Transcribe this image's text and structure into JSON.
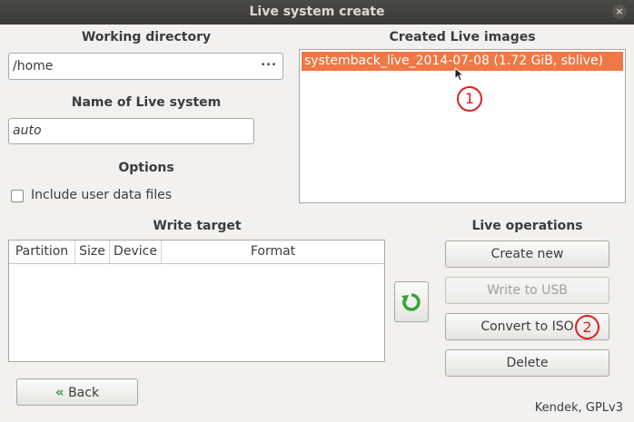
{
  "window": {
    "title": "Live system create",
    "close_glyph": "×"
  },
  "left": {
    "working_dir_label": "Working directory",
    "working_dir_value": "/home",
    "browse_label": "...",
    "name_label": "Name of Live system",
    "name_value": "auto",
    "options_label": "Options",
    "include_user_data_label": "Include user data files",
    "include_user_data_checked": false,
    "write_target_label": "Write target",
    "columns": [
      "Partition",
      "Size",
      "Device",
      "Format"
    ]
  },
  "right": {
    "created_label": "Created Live images",
    "images": [
      "systemback_live_2014-07-08 (1.72 GiB, sblive)"
    ],
    "operations_label": "Live operations",
    "buttons": {
      "create_new": "Create new",
      "write_usb": "Write to USB",
      "convert_iso": "Convert to ISO",
      "delete": "Delete"
    }
  },
  "back_label": "Back",
  "footer": "Kendek, GPLv3",
  "annotations": {
    "a1": "1",
    "a2": "2"
  },
  "colors": {
    "accent": "#f07746",
    "annotation": "#d8211f",
    "refresh": "#3aa23a"
  }
}
